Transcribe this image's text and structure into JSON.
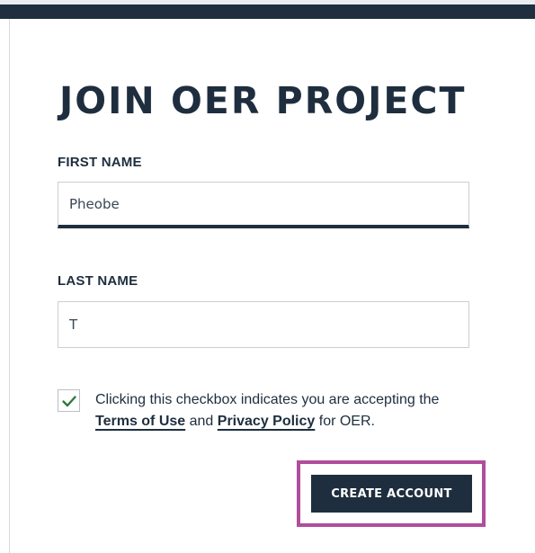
{
  "form": {
    "title": "JOIN OER PROJECT",
    "first_name": {
      "label": "FIRST NAME",
      "value": "Pheobe"
    },
    "last_name": {
      "label": "LAST NAME",
      "value": "T"
    },
    "consent": {
      "checked": true,
      "text_before": "Clicking this checkbox indicates you are accepting the ",
      "terms_link": "Terms of Use",
      "text_and": " and ",
      "privacy_link": "Privacy Policy",
      "text_after": " for OER."
    },
    "submit_label": "CREATE ACCOUNT"
  },
  "colors": {
    "navy": "#1e2e3e",
    "highlight": "#b04d9c",
    "check": "#2f7a3a"
  }
}
